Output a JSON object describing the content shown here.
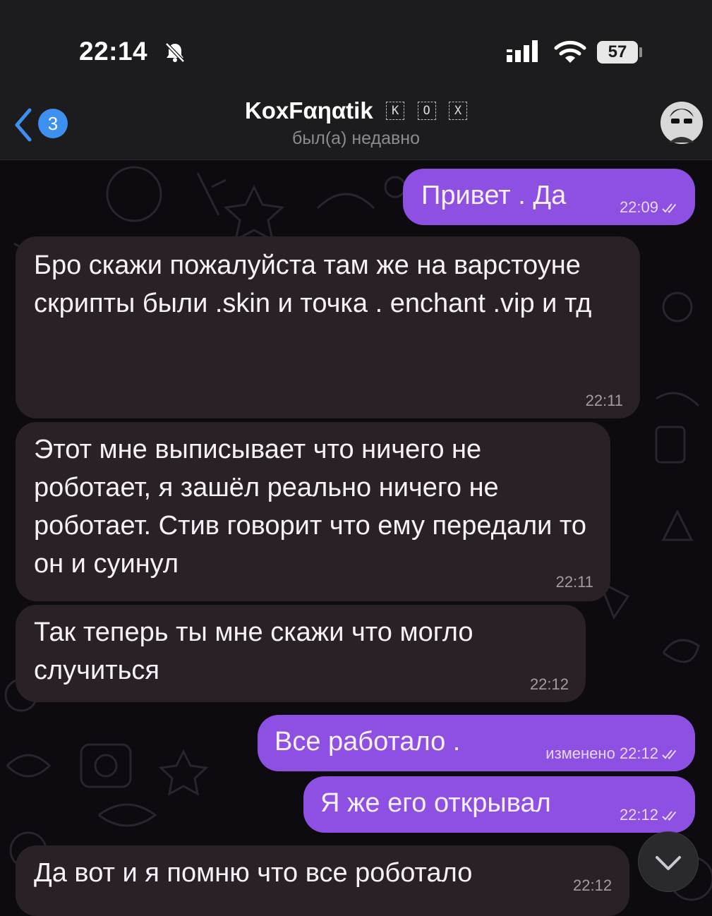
{
  "status_bar": {
    "time": "22:14",
    "battery": "57"
  },
  "header": {
    "unread_count": "3",
    "title": "KoxFαηαtik",
    "title_tags": [
      "K",
      "O",
      "X"
    ],
    "subtitle": "был(а) недавно"
  },
  "messages": [
    {
      "dir": "out",
      "text": "Привет . Да",
      "time": "22:09",
      "read": true
    },
    {
      "dir": "in",
      "text": "Бро скажи пожалуйста там же на варстоуне скрипты были .skin и точка . enchant .vip и тд",
      "time": "22:11"
    },
    {
      "dir": "in",
      "text": "Этот мне выписывает что ничего не роботает, я зашёл реально ничего не роботает. Стив говорит что ему передали то он и суинул",
      "time": "22:11"
    },
    {
      "dir": "in",
      "text": "Так теперь ты мне скажи что могло случиться",
      "time": "22:12"
    },
    {
      "dir": "out",
      "text": "Все работало .",
      "edited": "изменено",
      "time": "22:12",
      "read": true
    },
    {
      "dir": "out",
      "text": "Я же его открывал",
      "time": "22:12",
      "read": true
    },
    {
      "dir": "in",
      "text": "Да вот и я помню что все роботало",
      "time": "22:12"
    }
  ],
  "icons": {
    "back": "chevron-left-icon",
    "silent": "bell-slash-icon",
    "signal": "signal-icon",
    "wifi": "wifi-icon",
    "scroll": "chevron-down-icon"
  },
  "colors": {
    "incoming_bubble": "#2a2127",
    "outgoing_bubble": "#8e4fe3",
    "badge": "#3d8ff0",
    "background": "#0d0a10"
  }
}
